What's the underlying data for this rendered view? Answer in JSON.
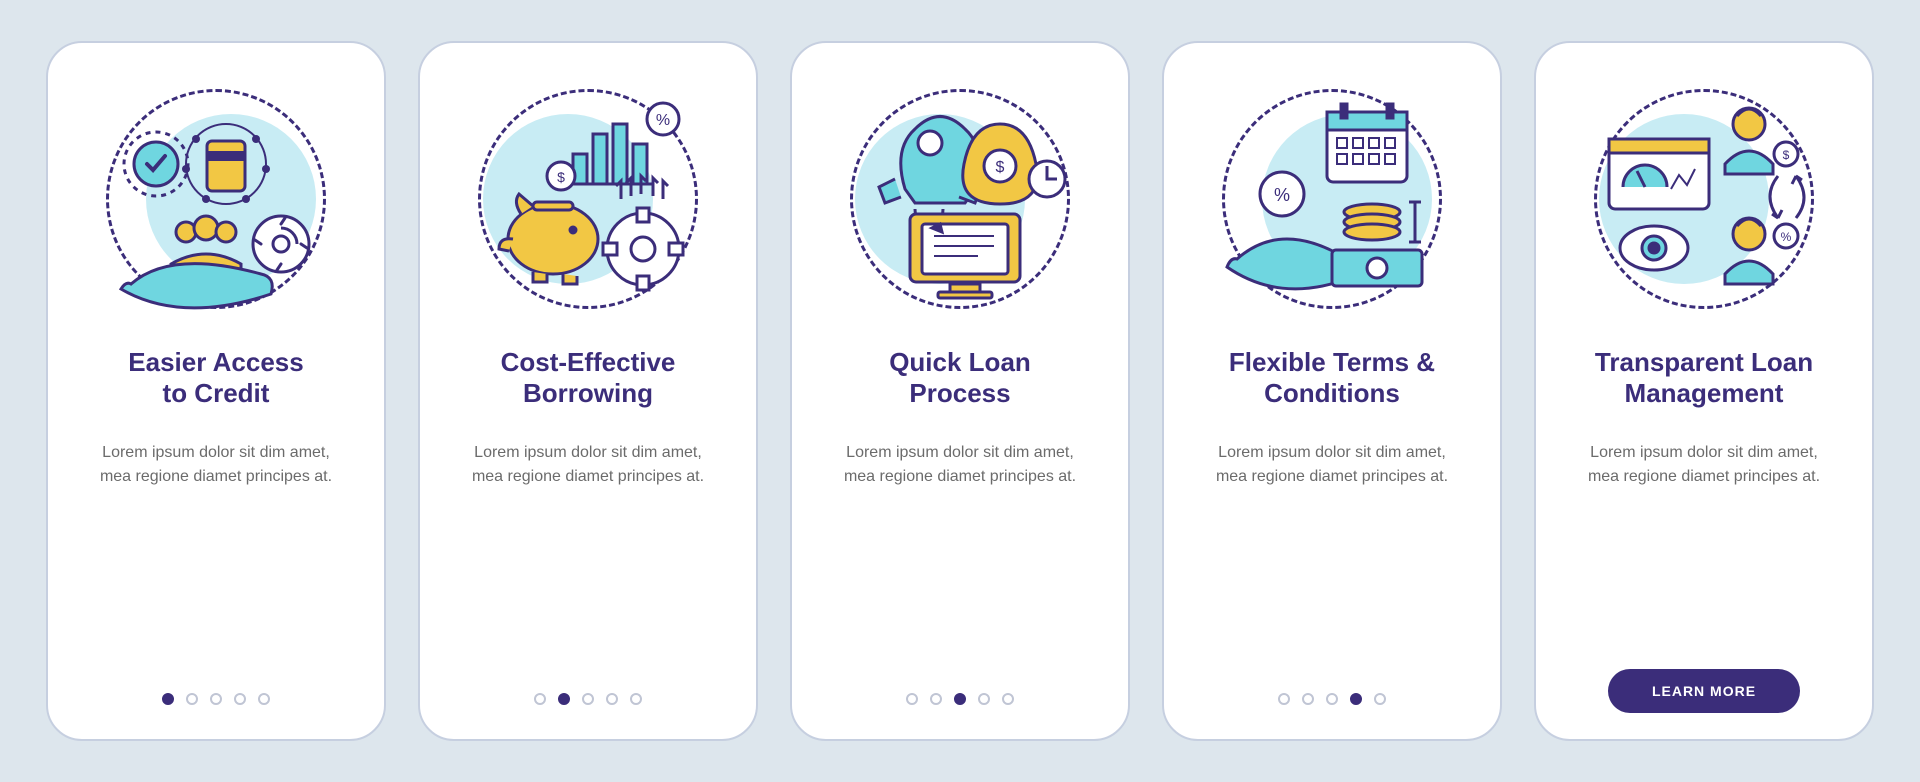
{
  "cards": [
    {
      "title": "Easier Access\nto Credit",
      "description": "Lorem ipsum dolor sit dim amet, mea regione diamet principes at.",
      "iconName": "access-credit-icon",
      "soft_circle_offset": "right",
      "dots_total": 5,
      "active_dot": 0,
      "has_cta": false
    },
    {
      "title": "Cost-Effective\nBorrowing",
      "description": "Lorem ipsum dolor sit dim amet, mea regione diamet principes at.",
      "iconName": "cost-effective-icon",
      "soft_circle_offset": "left",
      "dots_total": 5,
      "active_dot": 1,
      "has_cta": false
    },
    {
      "title": "Quick Loan\nProcess",
      "description": "Lorem ipsum dolor sit dim amet, mea regione diamet principes at.",
      "iconName": "quick-loan-icon",
      "soft_circle_offset": "left",
      "dots_total": 5,
      "active_dot": 2,
      "has_cta": false
    },
    {
      "title": "Flexible Terms &\nConditions",
      "description": "Lorem ipsum dolor sit dim amet, mea regione diamet principes at.",
      "iconName": "flexible-terms-icon",
      "soft_circle_offset": "right",
      "dots_total": 5,
      "active_dot": 3,
      "has_cta": false
    },
    {
      "title": "Transparent Loan\nManagement",
      "description": "Lorem ipsum dolor sit dim amet, mea regione diamet principes at.",
      "iconName": "transparent-loan-icon",
      "soft_circle_offset": "left",
      "dots_total": 5,
      "active_dot": 4,
      "has_cta": true
    }
  ],
  "cta_label": "LEARN MORE",
  "colors": {
    "primary": "#3b2d7a",
    "accent_yellow": "#f2c744",
    "accent_cyan": "#6fd6e0",
    "bg": "#dde6ed"
  }
}
